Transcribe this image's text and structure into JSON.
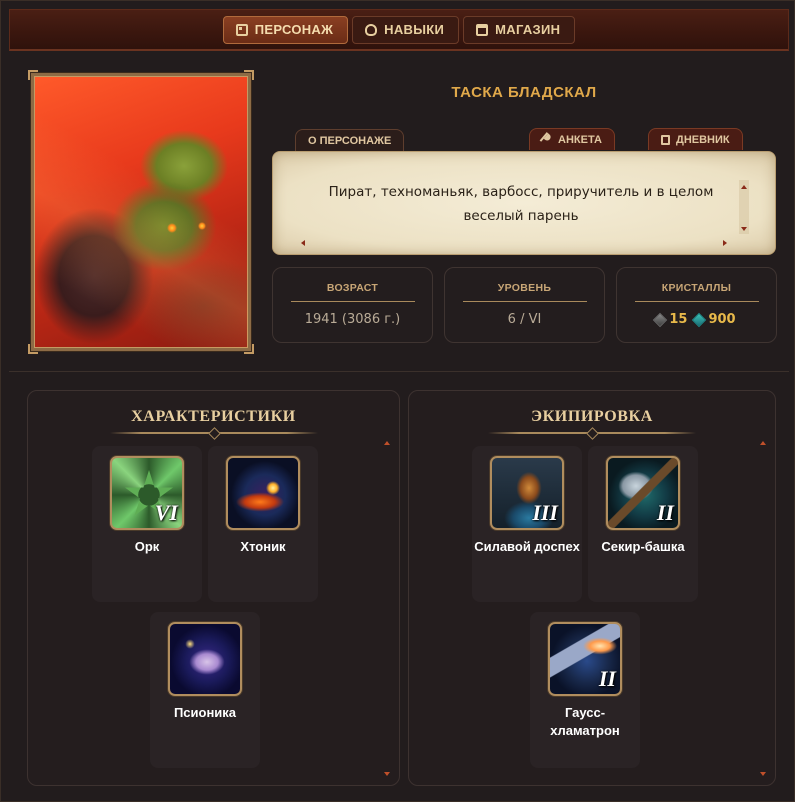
{
  "tabs": [
    {
      "label": "ПЕРСОНАЖ",
      "icon": "id-card-icon",
      "active": true
    },
    {
      "label": "НАВЫКИ",
      "icon": "lightbulb-icon",
      "active": false
    },
    {
      "label": "МАГАЗИН",
      "icon": "shop-icon",
      "active": false
    }
  ],
  "character": {
    "name": "ТАСКА БЛАДСКАЛ",
    "about_label": "О ПЕРСОНАЖЕ",
    "form_label": "АНКЕТА",
    "diary_label": "ДНЕВНИК",
    "description": "Пират, техноманьяк, варбосс, приручитель и в целом веселый парень"
  },
  "stats": {
    "age": {
      "label": "ВОЗРАСТ",
      "value": "1941 (3086 г.)"
    },
    "level": {
      "label": "УРОВЕНЬ",
      "value": "6 / VI"
    },
    "crystals": {
      "label": "КРИСТАЛЛЫ",
      "gray": "15",
      "teal": "900"
    }
  },
  "characteristics": {
    "title": "ХАРАКТЕРИСТИКИ",
    "items": [
      {
        "label": "Орк",
        "rank": "VI",
        "icon": "orc-emblem-icon"
      },
      {
        "label": "Хтоник",
        "rank": "",
        "icon": "chthonic-icon"
      },
      {
        "label": "Псионика",
        "rank": "",
        "icon": "psionics-brain-icon"
      }
    ]
  },
  "equipment": {
    "title": "ЭКИПИРОВКА",
    "items": [
      {
        "label": "Силавой доспех",
        "rank": "III",
        "icon": "power-armor-icon"
      },
      {
        "label": "Секир-башка",
        "rank": "II",
        "icon": "axe-icon"
      },
      {
        "label": "Гаусс-хламатрон",
        "rank": "II",
        "icon": "gauss-gun-icon"
      }
    ]
  },
  "colors": {
    "accent": "#e0a84a",
    "tab_active": "#8a3f22",
    "panel_bg": "#241d1e",
    "parchment": "#f4ecd6"
  }
}
